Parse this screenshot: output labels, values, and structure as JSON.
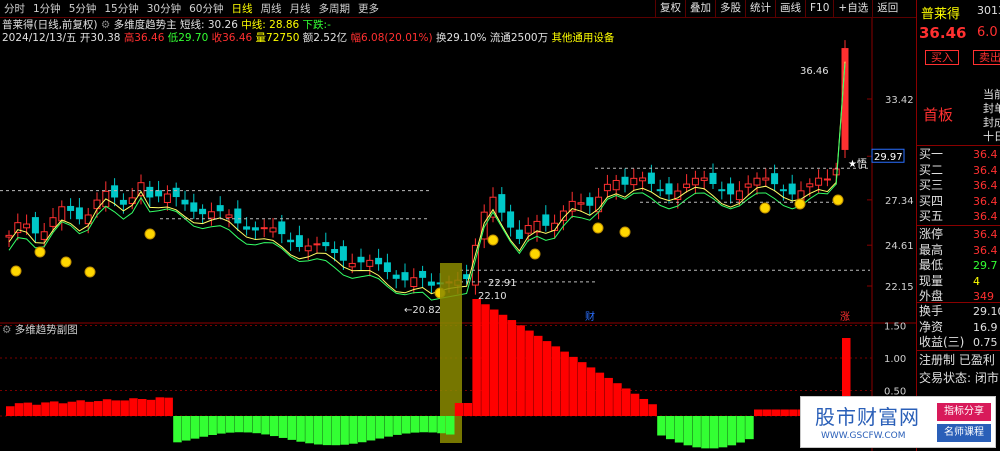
{
  "toolbar": {
    "periods": [
      "分时",
      "1分钟",
      "5分钟",
      "15分钟",
      "30分钟",
      "60分钟",
      "日线",
      "周线",
      "月线",
      "多周期",
      "更多"
    ],
    "active_period": "日线",
    "buttons": [
      "复权",
      "叠加",
      "多股",
      "统计",
      "画线",
      "F10",
      "+自选",
      "返回"
    ]
  },
  "info": {
    "stock_title": "普莱得(日线,前复权)",
    "indicator_name": "多维度趋势主",
    "short_label": "短线: 30.26",
    "mid_label": "中线: 28.86",
    "trend_label": "下跌:-",
    "date": "2024/12/13/五",
    "open": "开30.38",
    "high": "高36.46",
    "low": "低29.70",
    "close": "收36.46",
    "volume": "量72750",
    "amount": "额2.52亿",
    "amplitude": "幅6.08(20.01%)",
    "turnover": "换29.10%",
    "float": "流通2500万",
    "settings": "其他通用设备"
  },
  "sub_chart": {
    "title": "多维趋势副图"
  },
  "price_axis": [
    "33.42",
    "29.97",
    "27.34",
    "24.61",
    "22.15"
  ],
  "sub_axis": [
    "1.50",
    "1.00",
    "0.50"
  ],
  "annotations": {
    "peak": "36.46",
    "trough": "←20.82",
    "level1": "22.91",
    "level2": "22.10",
    "mark_cai": "财",
    "mark_zhang": "涨",
    "cross_label": "★悟"
  },
  "right_panel": {
    "name": "普莱得",
    "code": "30135",
    "price": "36.46",
    "change": "6.0",
    "buy_btn": "买入",
    "sell_btn": "卖出",
    "tag": "首板",
    "mini": [
      "当前",
      "封单",
      "封成",
      "十日"
    ],
    "orders": [
      {
        "label": "买一",
        "value": "36.4"
      },
      {
        "label": "买二",
        "value": "36.4"
      },
      {
        "label": "买三",
        "value": "36.4"
      },
      {
        "label": "买四",
        "value": "36.4"
      },
      {
        "label": "买五",
        "value": "36.4"
      }
    ],
    "stats": [
      {
        "label": "涨停",
        "value": "36.4"
      },
      {
        "label": "最高",
        "value": "36.4"
      },
      {
        "label": "最低",
        "value": "29.7"
      },
      {
        "label": "现量",
        "value": "4"
      },
      {
        "label": "外盘",
        "value": "349"
      }
    ],
    "stats2": [
      {
        "label": "换手",
        "value": "29.10"
      },
      {
        "label": "净资",
        "value": "16.9"
      },
      {
        "label": "收益(三)",
        "value": "0.75"
      }
    ],
    "notes": [
      "注册制 已盈利",
      "交易状态: 闭市"
    ]
  },
  "watermark": {
    "text": "股市财富网",
    "url": "WWW.GSCFW.COM",
    "tag1": "指标分享",
    "tag2": "名师课程"
  },
  "colors": {
    "up": "#ff3030",
    "down": "#00c8c8",
    "sub_up": "#ff0000",
    "sub_down": "#33ff33",
    "highlight": "#8b8b00"
  }
}
